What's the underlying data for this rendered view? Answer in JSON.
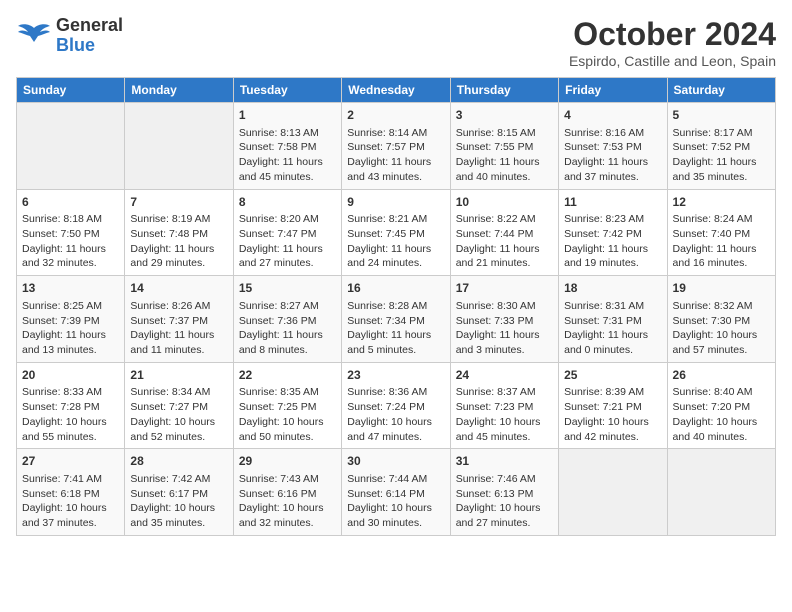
{
  "logo": {
    "line1": "General",
    "line2": "Blue"
  },
  "title": "October 2024",
  "subtitle": "Espirdo, Castille and Leon, Spain",
  "weekdays": [
    "Sunday",
    "Monday",
    "Tuesday",
    "Wednesday",
    "Thursday",
    "Friday",
    "Saturday"
  ],
  "weeks": [
    [
      {
        "day": "",
        "info": ""
      },
      {
        "day": "",
        "info": ""
      },
      {
        "day": "1",
        "info": "Sunrise: 8:13 AM\nSunset: 7:58 PM\nDaylight: 11 hours and 45 minutes."
      },
      {
        "day": "2",
        "info": "Sunrise: 8:14 AM\nSunset: 7:57 PM\nDaylight: 11 hours and 43 minutes."
      },
      {
        "day": "3",
        "info": "Sunrise: 8:15 AM\nSunset: 7:55 PM\nDaylight: 11 hours and 40 minutes."
      },
      {
        "day": "4",
        "info": "Sunrise: 8:16 AM\nSunset: 7:53 PM\nDaylight: 11 hours and 37 minutes."
      },
      {
        "day": "5",
        "info": "Sunrise: 8:17 AM\nSunset: 7:52 PM\nDaylight: 11 hours and 35 minutes."
      }
    ],
    [
      {
        "day": "6",
        "info": "Sunrise: 8:18 AM\nSunset: 7:50 PM\nDaylight: 11 hours and 32 minutes."
      },
      {
        "day": "7",
        "info": "Sunrise: 8:19 AM\nSunset: 7:48 PM\nDaylight: 11 hours and 29 minutes."
      },
      {
        "day": "8",
        "info": "Sunrise: 8:20 AM\nSunset: 7:47 PM\nDaylight: 11 hours and 27 minutes."
      },
      {
        "day": "9",
        "info": "Sunrise: 8:21 AM\nSunset: 7:45 PM\nDaylight: 11 hours and 24 minutes."
      },
      {
        "day": "10",
        "info": "Sunrise: 8:22 AM\nSunset: 7:44 PM\nDaylight: 11 hours and 21 minutes."
      },
      {
        "day": "11",
        "info": "Sunrise: 8:23 AM\nSunset: 7:42 PM\nDaylight: 11 hours and 19 minutes."
      },
      {
        "day": "12",
        "info": "Sunrise: 8:24 AM\nSunset: 7:40 PM\nDaylight: 11 hours and 16 minutes."
      }
    ],
    [
      {
        "day": "13",
        "info": "Sunrise: 8:25 AM\nSunset: 7:39 PM\nDaylight: 11 hours and 13 minutes."
      },
      {
        "day": "14",
        "info": "Sunrise: 8:26 AM\nSunset: 7:37 PM\nDaylight: 11 hours and 11 minutes."
      },
      {
        "day": "15",
        "info": "Sunrise: 8:27 AM\nSunset: 7:36 PM\nDaylight: 11 hours and 8 minutes."
      },
      {
        "day": "16",
        "info": "Sunrise: 8:28 AM\nSunset: 7:34 PM\nDaylight: 11 hours and 5 minutes."
      },
      {
        "day": "17",
        "info": "Sunrise: 8:30 AM\nSunset: 7:33 PM\nDaylight: 11 hours and 3 minutes."
      },
      {
        "day": "18",
        "info": "Sunrise: 8:31 AM\nSunset: 7:31 PM\nDaylight: 11 hours and 0 minutes."
      },
      {
        "day": "19",
        "info": "Sunrise: 8:32 AM\nSunset: 7:30 PM\nDaylight: 10 hours and 57 minutes."
      }
    ],
    [
      {
        "day": "20",
        "info": "Sunrise: 8:33 AM\nSunset: 7:28 PM\nDaylight: 10 hours and 55 minutes."
      },
      {
        "day": "21",
        "info": "Sunrise: 8:34 AM\nSunset: 7:27 PM\nDaylight: 10 hours and 52 minutes."
      },
      {
        "day": "22",
        "info": "Sunrise: 8:35 AM\nSunset: 7:25 PM\nDaylight: 10 hours and 50 minutes."
      },
      {
        "day": "23",
        "info": "Sunrise: 8:36 AM\nSunset: 7:24 PM\nDaylight: 10 hours and 47 minutes."
      },
      {
        "day": "24",
        "info": "Sunrise: 8:37 AM\nSunset: 7:23 PM\nDaylight: 10 hours and 45 minutes."
      },
      {
        "day": "25",
        "info": "Sunrise: 8:39 AM\nSunset: 7:21 PM\nDaylight: 10 hours and 42 minutes."
      },
      {
        "day": "26",
        "info": "Sunrise: 8:40 AM\nSunset: 7:20 PM\nDaylight: 10 hours and 40 minutes."
      }
    ],
    [
      {
        "day": "27",
        "info": "Sunrise: 7:41 AM\nSunset: 6:18 PM\nDaylight: 10 hours and 37 minutes."
      },
      {
        "day": "28",
        "info": "Sunrise: 7:42 AM\nSunset: 6:17 PM\nDaylight: 10 hours and 35 minutes."
      },
      {
        "day": "29",
        "info": "Sunrise: 7:43 AM\nSunset: 6:16 PM\nDaylight: 10 hours and 32 minutes."
      },
      {
        "day": "30",
        "info": "Sunrise: 7:44 AM\nSunset: 6:14 PM\nDaylight: 10 hours and 30 minutes."
      },
      {
        "day": "31",
        "info": "Sunrise: 7:46 AM\nSunset: 6:13 PM\nDaylight: 10 hours and 27 minutes."
      },
      {
        "day": "",
        "info": ""
      },
      {
        "day": "",
        "info": ""
      }
    ]
  ]
}
